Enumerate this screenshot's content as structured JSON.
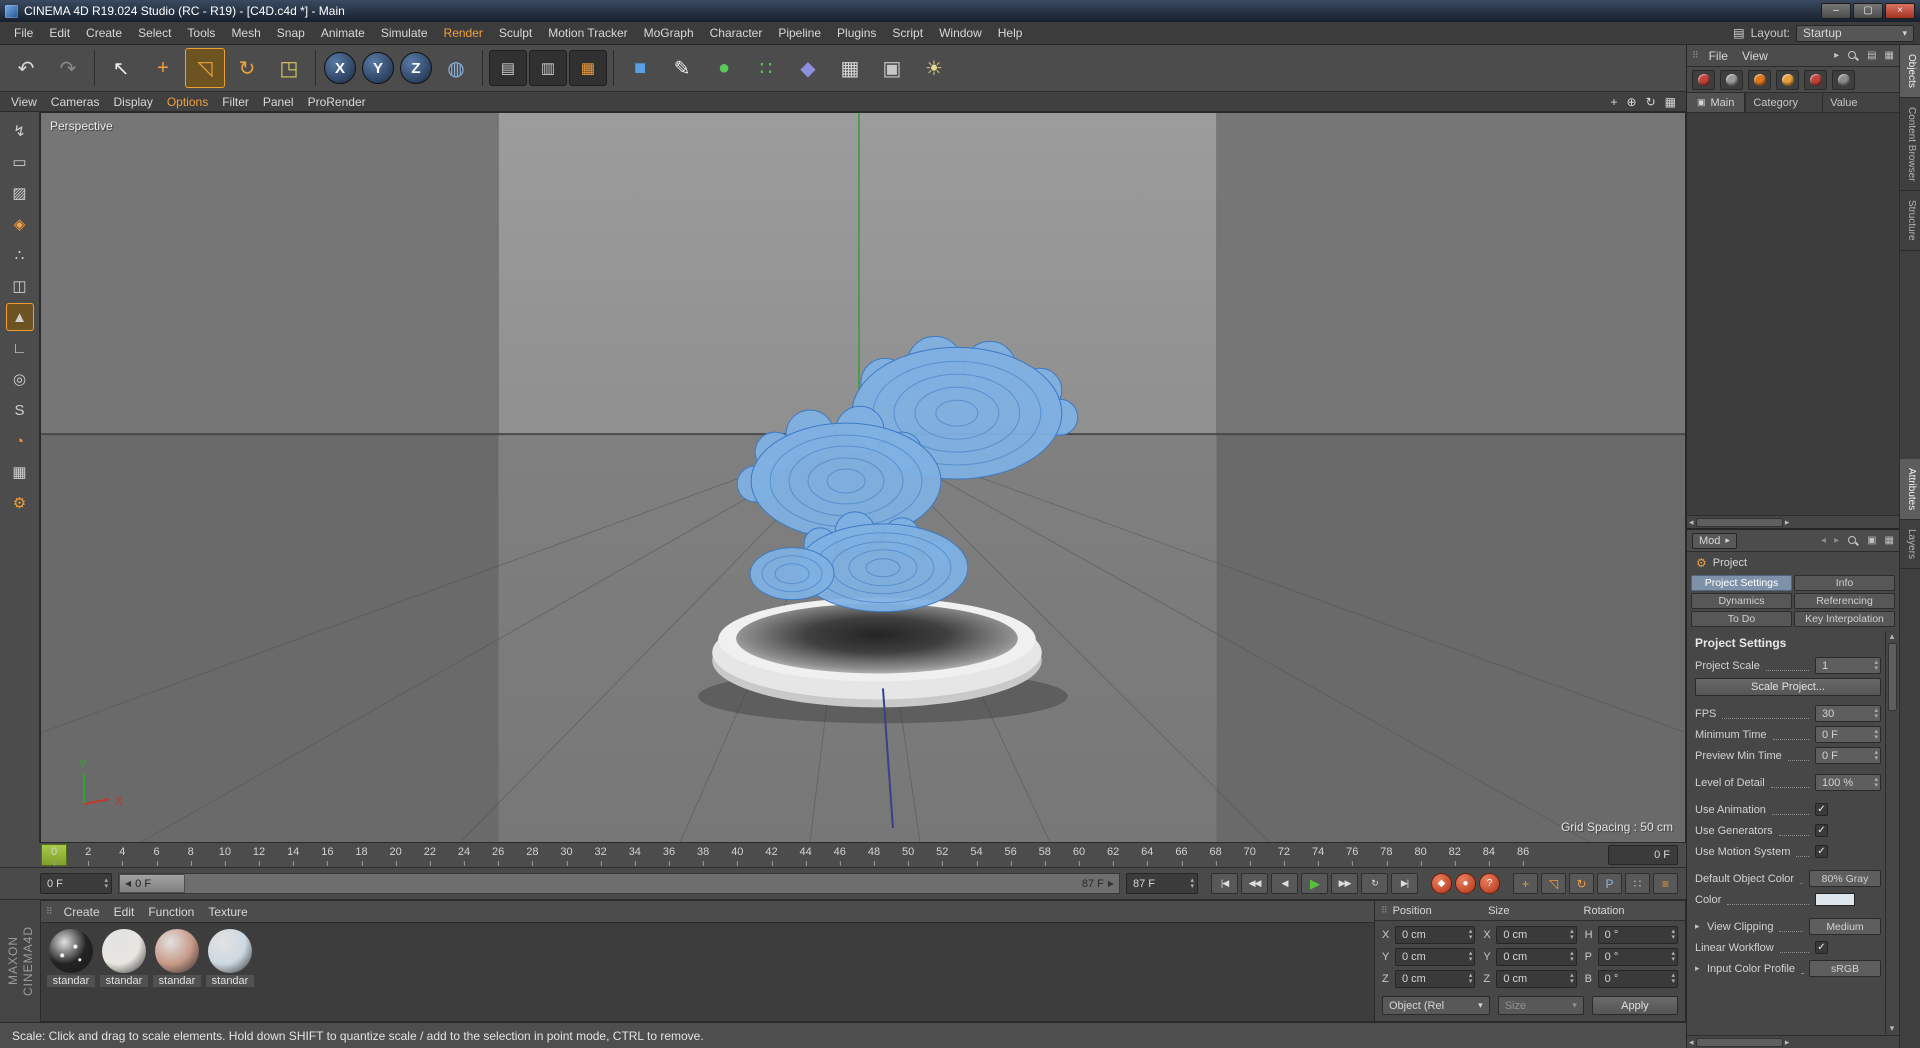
{
  "window": {
    "title": "CINEMA 4D R19.024 Studio (RC - R19) - [C4D.c4d *] - Main",
    "controls": {
      "minimize": "–",
      "maximize": "▢",
      "close": "×"
    }
  },
  "layout_switcher": {
    "label": "Layout:",
    "value": "Startup"
  },
  "menubar": {
    "items": [
      {
        "label": "File"
      },
      {
        "label": "Edit"
      },
      {
        "label": "Create"
      },
      {
        "label": "Select"
      },
      {
        "label": "Tools"
      },
      {
        "label": "Mesh"
      },
      {
        "label": "Snap"
      },
      {
        "label": "Animate"
      },
      {
        "label": "Simulate"
      },
      {
        "label": "Render",
        "accent": true
      },
      {
        "label": "Sculpt"
      },
      {
        "label": "Motion Tracker"
      },
      {
        "label": "MoGraph"
      },
      {
        "label": "Character"
      },
      {
        "label": "Pipeline"
      },
      {
        "label": "Plugins"
      },
      {
        "label": "Script"
      },
      {
        "label": "Window"
      },
      {
        "label": "Help"
      }
    ]
  },
  "toolbar": {
    "items": [
      {
        "name": "undo-button",
        "glyph": "↶",
        "fg": "#d8d8d8"
      },
      {
        "name": "redo-button",
        "glyph": "↷",
        "fg": "#8a8a8a"
      },
      {
        "name": "live-selection-tool",
        "glyph": "↖",
        "fg": "#ececec",
        "sep": true
      },
      {
        "name": "move-tool",
        "glyph": "+",
        "fg": "#f0a03c"
      },
      {
        "name": "scale-tool",
        "glyph": "◹",
        "fg": "#f0a03c",
        "active": true
      },
      {
        "name": "rotate-tool",
        "glyph": "↻",
        "fg": "#f0a03c"
      },
      {
        "name": "last-used-tool",
        "glyph": "◳",
        "fg": "#d8c860"
      },
      {
        "name": "lock-x-axis-button",
        "glyph": "X",
        "axis": true,
        "sep": true
      },
      {
        "name": "lock-y-axis-button",
        "glyph": "Y",
        "axis": true
      },
      {
        "name": "lock-z-axis-button",
        "glyph": "Z",
        "axis": true
      },
      {
        "name": "coordinate-system-button",
        "glyph": "◍",
        "fg": "#8ab4e4"
      },
      {
        "name": "render-view-button",
        "glyph": "▤",
        "fg": "#cccccc",
        "dark": true,
        "sep": true
      },
      {
        "name": "render-picture-viewer-button",
        "glyph": "▥",
        "fg": "#cccccc",
        "dark": true
      },
      {
        "name": "render-settings-button",
        "glyph": "▦",
        "fg": "#f0a03c",
        "dark": true
      },
      {
        "name": "add-cube-button",
        "glyph": "■",
        "fg": "#5aa0e8",
        "sep": true
      },
      {
        "name": "add-spline-button",
        "glyph": "✎",
        "fg": "#ececec"
      },
      {
        "name": "add-subdivision-surface-button",
        "glyph": "●",
        "fg": "#58c858"
      },
      {
        "name": "add-array-button",
        "glyph": "∷",
        "fg": "#58c858"
      },
      {
        "name": "add-deformer-button",
        "glyph": "◆",
        "fg": "#8e8ede"
      },
      {
        "name": "add-floor-button",
        "glyph": "▦",
        "fg": "#d8d8d8"
      },
      {
        "name": "add-camera-button",
        "glyph": "▣",
        "fg": "#c8c8c8"
      },
      {
        "name": "add-light-button",
        "glyph": "☀",
        "fg": "#e8d890"
      }
    ]
  },
  "palette": {
    "items": [
      {
        "name": "make-editable-button",
        "glyph": "↯"
      },
      {
        "name": "model-mode-button",
        "glyph": "▭"
      },
      {
        "name": "texture-mode-button",
        "glyph": "▨"
      },
      {
        "name": "workplane-mode-button",
        "glyph": "◈",
        "fg": "#f0a03c"
      },
      {
        "name": "points-mode-button",
        "glyph": "∴"
      },
      {
        "name": "edges-mode-button",
        "glyph": "◫"
      },
      {
        "name": "polygons-mode-button",
        "glyph": "▲",
        "active": true
      },
      {
        "name": "axis-mode-button",
        "glyph": "∟"
      },
      {
        "name": "viewport-solo-button",
        "glyph": "◎"
      },
      {
        "name": "snap-button",
        "glyph": "S"
      },
      {
        "name": "quantize-button",
        "glyph": "◔",
        "fg": "#f0a03c"
      },
      {
        "name": "lock-workplane-button",
        "glyph": "▦"
      },
      {
        "name": "workplane-settings-button",
        "glyph": "⚙",
        "fg": "#f0a03c"
      }
    ]
  },
  "viewport": {
    "menus": [
      {
        "label": "View"
      },
      {
        "label": "Cameras"
      },
      {
        "label": "Display"
      },
      {
        "label": "Options",
        "accent": true
      },
      {
        "label": "Filter"
      },
      {
        "label": "Panel"
      },
      {
        "label": "ProRender"
      }
    ],
    "view_icons": [
      {
        "name": "pan-view-icon",
        "glyph": "+"
      },
      {
        "name": "zoom-view-icon",
        "glyph": "⊕"
      },
      {
        "name": "rotate-view-icon",
        "glyph": "↻"
      },
      {
        "name": "toggle-views-icon",
        "glyph": "▦"
      }
    ],
    "label": "Perspective",
    "grid_spacing": "Grid Spacing : 50 cm",
    "axis_y": "Y",
    "axis_x": "X"
  },
  "timeline": {
    "ticks": [
      "0",
      "2",
      "4",
      "6",
      "8",
      "10",
      "12",
      "14",
      "16",
      "18",
      "20",
      "22",
      "24",
      "26",
      "28",
      "30",
      "32",
      "34",
      "36",
      "38",
      "40",
      "42",
      "44",
      "46",
      "48",
      "50",
      "52",
      "54",
      "56",
      "58",
      "60",
      "62",
      "64",
      "66",
      "68",
      "70",
      "72",
      "74",
      "76",
      "78",
      "80",
      "82",
      "84",
      "86"
    ],
    "ruler_end_field": "0 F",
    "current_frame_field": "0 F",
    "slider_marker": "0 F",
    "slider_end": "87 F",
    "end_frame_field": "87 F"
  },
  "transport": {
    "buttons": [
      {
        "name": "goto-start-button",
        "glyph": "|◀"
      },
      {
        "name": "previous-key-button",
        "glyph": "◀◀"
      },
      {
        "name": "previous-frame-button",
        "glyph": "◀"
      },
      {
        "name": "play-button",
        "glyph": "▶",
        "accent": "#55c23e"
      },
      {
        "name": "next-key-button",
        "glyph": "▶▶"
      },
      {
        "name": "play-mode-button",
        "glyph": "↻"
      },
      {
        "name": "goto-end-button",
        "glyph": "▶|"
      }
    ],
    "record_buttons": [
      {
        "name": "record-keyframe-button",
        "glyph": "◆"
      },
      {
        "name": "autokeying-button",
        "glyph": "●"
      },
      {
        "name": "keyframe-selection-button",
        "glyph": "?"
      }
    ],
    "toggle_buttons": [
      {
        "name": "record-position-toggle",
        "glyph": "+",
        "fg": "#f0a03c"
      },
      {
        "name": "record-scale-toggle",
        "glyph": "◹",
        "fg": "#f0a03c"
      },
      {
        "name": "record-rotation-toggle",
        "glyph": "↻",
        "fg": "#f0a03c"
      },
      {
        "name": "record-parameter-toggle",
        "glyph": "P",
        "fg": "#8ab4e4"
      },
      {
        "name": "record-pla-toggle",
        "glyph": "∷",
        "fg": "#b8b8b8"
      },
      {
        "name": "timeline-button",
        "glyph": "≡",
        "fg": "#f0a03c"
      }
    ]
  },
  "materials": {
    "menus": [
      {
        "label": "Create"
      },
      {
        "label": "Edit"
      },
      {
        "label": "Function"
      },
      {
        "label": "Texture"
      }
    ],
    "items": [
      {
        "label": "standar",
        "color": "#232323",
        "speckled": true
      },
      {
        "label": "standar",
        "color": "#e9e6e1"
      },
      {
        "label": "standar",
        "color": "#c79a88"
      },
      {
        "label": "standar",
        "color": "#cdd9e2"
      }
    ]
  },
  "coordinates": {
    "headers": [
      "Position",
      "Size",
      "Rotation"
    ],
    "rows": [
      {
        "cells": [
          {
            "label": "X",
            "value": "0 cm"
          },
          {
            "label": "X",
            "value": "0 cm"
          },
          {
            "label": "H",
            "value": "0 °"
          }
        ]
      },
      {
        "cells": [
          {
            "label": "Y",
            "value": "0 cm"
          },
          {
            "label": "Y",
            "value": "0 cm"
          },
          {
            "label": "P",
            "value": "0 °"
          }
        ]
      },
      {
        "cells": [
          {
            "label": "Z",
            "value": "0 cm"
          },
          {
            "label": "Z",
            "value": "0 cm"
          },
          {
            "label": "B",
            "value": "0 °"
          }
        ]
      }
    ],
    "mode_dropdown": "Object (Rel",
    "size_dropdown": "Size",
    "apply_button": "Apply"
  },
  "object_manager": {
    "menus": [
      {
        "label": "File"
      },
      {
        "label": "View"
      }
    ],
    "header_icons": [
      {
        "name": "chevron-right-icon",
        "glyph": "▸"
      },
      {
        "name": "search-icon",
        "mag": true
      },
      {
        "name": "panel-layout-icon",
        "glyph": "▤"
      },
      {
        "name": "panel-menu-icon",
        "glyph": "▦"
      }
    ],
    "icons": [
      {
        "name": "material-filter-icon",
        "color": "#c0443a"
      },
      {
        "name": "shader-filter-icon",
        "color": "#9a9a9a"
      },
      {
        "name": "prorender-icon",
        "color": "#e07820"
      },
      {
        "name": "render-filter-icon",
        "color": "#e8a13c"
      },
      {
        "name": "record-filter-icon",
        "color": "#c0443a"
      },
      {
        "name": "layer-filter-icon",
        "color": "#8a8a8a"
      }
    ],
    "tab": "Main",
    "columns": [
      "Category",
      "Value"
    ]
  },
  "attributes": {
    "mode_dropdown": "Mod",
    "title_row": {
      "label": "Project"
    },
    "header_icons": [
      {
        "name": "history-back-icon",
        "glyph": "◂",
        "dim": true
      },
      {
        "name": "history-forward-icon",
        "glyph": "▸",
        "dim": true
      },
      {
        "name": "search-icon",
        "mag": true
      },
      {
        "name": "lock-icon",
        "glyph": "▣"
      },
      {
        "name": "panel-menu-icon",
        "glyph": "▦"
      }
    ],
    "tabs": [
      {
        "label": "Project Settings",
        "active": true
      },
      {
        "label": "Info"
      },
      {
        "label": "Dynamics"
      },
      {
        "label": "Referencing"
      },
      {
        "label": "To Do"
      },
      {
        "label": "Key Interpolation"
      }
    ],
    "section_title": "Project Settings",
    "fields": [
      {
        "label": "Project Scale",
        "type": "stepper",
        "value": "1"
      },
      {
        "label": "Scale Project...",
        "type": "button"
      },
      {
        "label": "FPS",
        "type": "stepper",
        "value": "30",
        "gap": true
      },
      {
        "label": "Minimum Time",
        "type": "stepper",
        "value": "0 F"
      },
      {
        "label": "Preview Min Time",
        "type": "stepper",
        "value": "0 F"
      },
      {
        "label": "Level of Detail",
        "type": "stepper",
        "value": "100 %",
        "gap": true
      },
      {
        "label": "Use Animation",
        "type": "check",
        "checked": true,
        "gap": true
      },
      {
        "label": "Use Generators",
        "type": "check",
        "checked": true
      },
      {
        "label": "Use Motion System",
        "type": "check",
        "checked": true
      },
      {
        "label": "Default Object Color",
        "type": "dropdown",
        "value": "80% Gray",
        "gap": true
      },
      {
        "label": "Color",
        "type": "color",
        "value": "#dfe7ee"
      },
      {
        "label": "View Clipping",
        "type": "dropdown",
        "value": "Medium",
        "arrow": true,
        "gap": true
      },
      {
        "label": "Linear Workflow",
        "type": "check",
        "checked": true
      },
      {
        "label": "Input Color Profile",
        "type": "dropdown",
        "value": "sRGB",
        "arrow": true
      }
    ]
  },
  "side_tabs": {
    "upper": [
      {
        "label": "Objects",
        "active": true
      },
      {
        "label": "Content Browser"
      },
      {
        "label": "Structure"
      }
    ],
    "lower": [
      {
        "label": "Attributes",
        "active": true
      },
      {
        "label": "Layers"
      }
    ]
  },
  "status_bar": {
    "text": "Scale: Click and drag to scale elements. Hold down SHIFT to quantize scale / add to the selection in point mode, CTRL to remove."
  },
  "branding": {
    "line1": "MAXON",
    "line2": "CINEMA4D"
  },
  "colors": {
    "accent_orange": "#f0a03c",
    "play_green": "#55c23e",
    "record_red": "#c0443a",
    "active_tab_blue": "#7d92a8",
    "timeline_marker_green": "#8fae3a",
    "cloud_blue": "#7fb0e2"
  },
  "icons": {
    "layout_palette": "▤",
    "chevron_down": "▾",
    "chevron_right": "▸",
    "stepper_up": "▴",
    "stepper_down": "▾",
    "scroll_up": "▴",
    "scroll_down": "▾",
    "scroll_left": "◂",
    "scroll_right": "▸",
    "handle": "⠿",
    "window_tab": "▣",
    "gear": "⚙",
    "slider_left": "◀",
    "slider_right": "▶",
    "check": "✓"
  }
}
